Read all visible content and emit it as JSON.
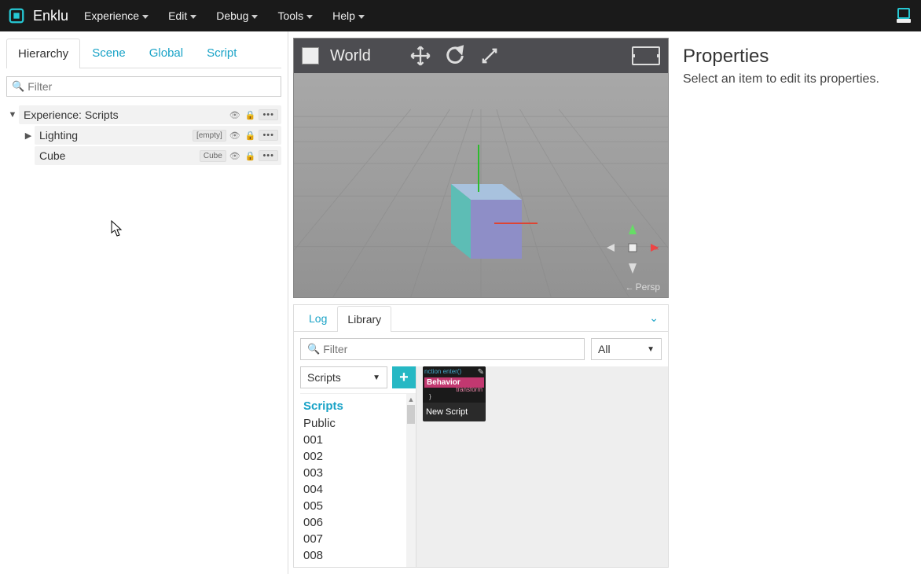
{
  "brand": "Enklu",
  "menu": [
    "Experience",
    "Edit",
    "Debug",
    "Tools",
    "Help"
  ],
  "left": {
    "tabs": [
      "Hierarchy",
      "Scene",
      "Global",
      "Script"
    ],
    "activeTab": 0,
    "filterPlaceholder": "Filter",
    "tree": {
      "root": "Experience: Scripts",
      "children": [
        {
          "name": "Lighting",
          "badge": "[empty]"
        },
        {
          "name": "Cube",
          "badge": "Cube"
        }
      ]
    }
  },
  "viewport": {
    "title": "World",
    "cameraLabel": "Persp"
  },
  "bottom": {
    "tabs": [
      "Log",
      "Library"
    ],
    "activeTab": 1,
    "filterPlaceholder": "Filter",
    "filterAll": "All",
    "category": "Scripts",
    "listHeader": "Scripts",
    "listItems": [
      "Public",
      "001",
      "002",
      "003",
      "004",
      "005",
      "006",
      "007",
      "008"
    ],
    "card": {
      "code1": "nction enter()",
      "behavior": "Behavior",
      "code2": "transform",
      "brace": "}",
      "name": "New Script"
    }
  },
  "properties": {
    "title": "Properties",
    "message": "Select an item to edit its properties."
  }
}
